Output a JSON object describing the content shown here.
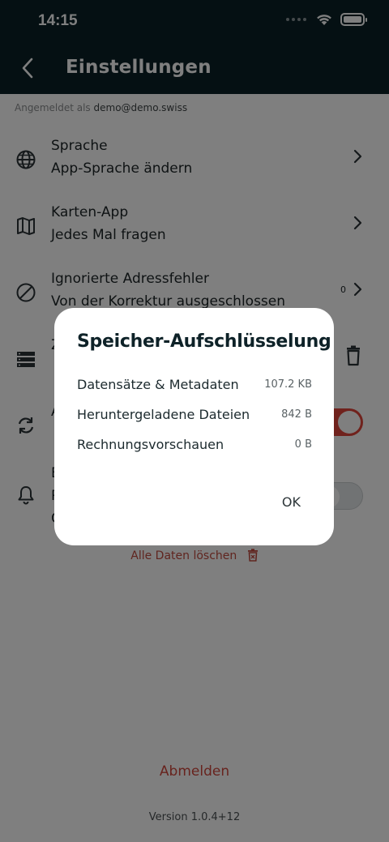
{
  "status_bar": {
    "time": "14:15"
  },
  "header": {
    "title": "Einstellungen"
  },
  "account": {
    "prefix": "Angemeldet als",
    "email": "demo@demo.swiss"
  },
  "settings": {
    "language": {
      "title": "Sprache",
      "subtitle": "App-Sprache ändern"
    },
    "maps": {
      "title": "Karten-App",
      "subtitle": "Jedes Mal fragen"
    },
    "ignored": {
      "title": "Ignorierte Adressfehler",
      "subtitle": "Von der Korrektur ausgeschlossen",
      "count": "0"
    },
    "storage": {
      "title": "Z",
      "subtitle": ""
    },
    "sync": {
      "title": "A",
      "subtitle": ""
    },
    "notifications": {
      "title": "B",
      "subtitle": "R",
      "extra": "C"
    }
  },
  "clear_all_label": "Alle Daten löschen",
  "logout_label": "Abmelden",
  "version": "Version 1.0.4+12",
  "dialog": {
    "title": "Speicher-Aufschlüsselung",
    "rows": [
      {
        "label": "Datensätze & Metadaten",
        "value": "107.2 KB"
      },
      {
        "label": "Heruntergeladene Dateien",
        "value": "842 B"
      },
      {
        "label": "Rechnungsvorschauen",
        "value": "0 B"
      }
    ],
    "ok_label": "OK"
  },
  "colors": {
    "header_bg": "#0b2127",
    "accent_red": "#e0453a",
    "danger_text": "#c04a3f"
  },
  "icons": [
    "chevron-left-icon",
    "globe-icon",
    "map-icon",
    "block-icon",
    "storage-icon",
    "sync-icon",
    "bell-icon",
    "chevron-right-icon",
    "trash-icon",
    "wifi-icon",
    "battery-icon"
  ]
}
